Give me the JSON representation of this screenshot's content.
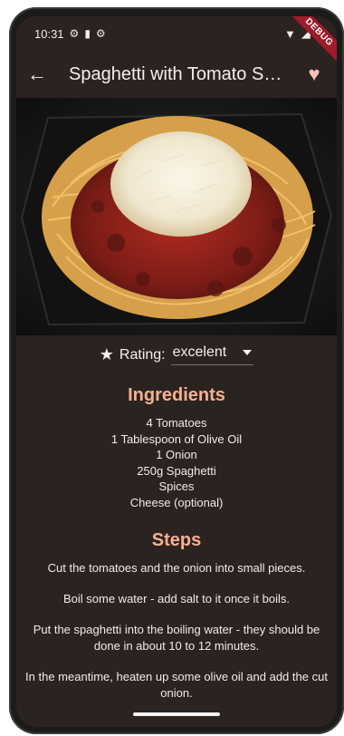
{
  "status": {
    "time": "10:31",
    "left_icons": [
      "gear-icon",
      "sd-card-icon",
      "gear-icon"
    ],
    "right_icons": [
      "wifi-icon",
      "signal-icon",
      "battery-icon"
    ]
  },
  "appbar": {
    "title": "Spaghetti with Tomato Sau…"
  },
  "debug_banner": "DEBUG",
  "rating": {
    "label": "Rating:",
    "value": "excelent"
  },
  "ingredients": {
    "title": "Ingredients",
    "items": [
      "4 Tomatoes",
      "1 Tablespoon of Olive Oil",
      "1 Onion",
      "250g Spaghetti",
      "Spices",
      "Cheese (optional)"
    ]
  },
  "steps": {
    "title": "Steps",
    "items": [
      "Cut the tomatoes and the onion into small pieces.",
      "Boil some water - add salt to it once it boils.",
      "Put the spaghetti into the boiling water - they should be done in about 10 to 12 minutes.",
      "In the meantime, heaten up some olive oil and add the cut onion."
    ]
  },
  "colors": {
    "background": "#2b2320",
    "accent": "#f6b192",
    "text": "#f1ebe7"
  }
}
